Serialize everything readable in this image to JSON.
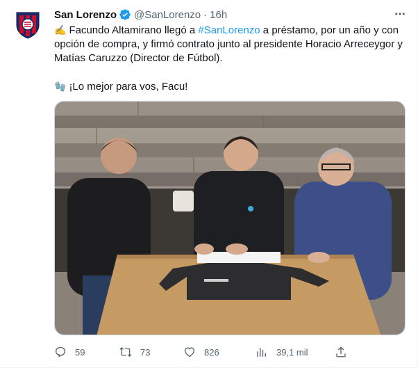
{
  "tweet": {
    "display_name": "San Lorenzo",
    "handle": "@SanLorenzo",
    "separator": "·",
    "time": "16h",
    "verified": true,
    "text": {
      "line1_emoji": "✍️",
      "line1_before": "Facundo Altamirano llegó a ",
      "hashtag": "#SanLorenzo",
      "line1_after": " a préstamo, por un año y con opción de compra, y firmó contrato junto al presidente Horacio Arreceygor y Matías Caruzzo (Director de Fútbol).",
      "line2_emoji": "🧤",
      "line2": "¡Lo mejor para vos, Facu!"
    },
    "actions": {
      "replies": "59",
      "retweets": "73",
      "likes": "826",
      "views": "39,1 mil"
    }
  },
  "colors": {
    "accent": "#1d9bf0",
    "secondary_text": "#536471",
    "club_blue": "#1b2a6b",
    "club_red": "#c8102e"
  },
  "icons": [
    "club-crest-icon",
    "verified-badge-icon",
    "more-options-icon",
    "reply-icon",
    "retweet-icon",
    "like-icon",
    "views-icon",
    "share-icon"
  ]
}
